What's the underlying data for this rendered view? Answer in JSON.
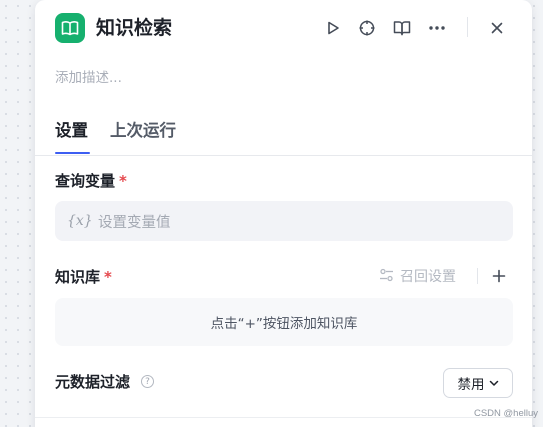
{
  "node": {
    "title": "知识检索",
    "description_placeholder": "添加描述..."
  },
  "header_actions": {
    "run_icon": "play-icon",
    "locate_icon": "crosshair-icon",
    "docs_icon": "book-open-icon",
    "more_icon": "more-horizontal-icon",
    "close_icon": "close-icon"
  },
  "tabs": [
    {
      "label": "设置",
      "active": true
    },
    {
      "label": "上次运行",
      "active": false
    }
  ],
  "query_variable": {
    "label": "查询变量",
    "required_mark": "*",
    "icon_text": "{x}",
    "placeholder": "设置变量值"
  },
  "knowledge_base": {
    "label": "知识库",
    "required_mark": "*",
    "recall_settings_label": "召回设置",
    "add_icon": "plus-icon",
    "empty_hint": "点击“+”按钮添加知识库"
  },
  "metadata_filter": {
    "label": "元数据过滤",
    "help_icon": "question-circle-icon",
    "selected_value": "禁用"
  },
  "watermark": "CSDN @helluy",
  "colors": {
    "brand_green": "#16b06e",
    "accent_blue": "#3d5ef2",
    "required_red": "#e5484d"
  }
}
